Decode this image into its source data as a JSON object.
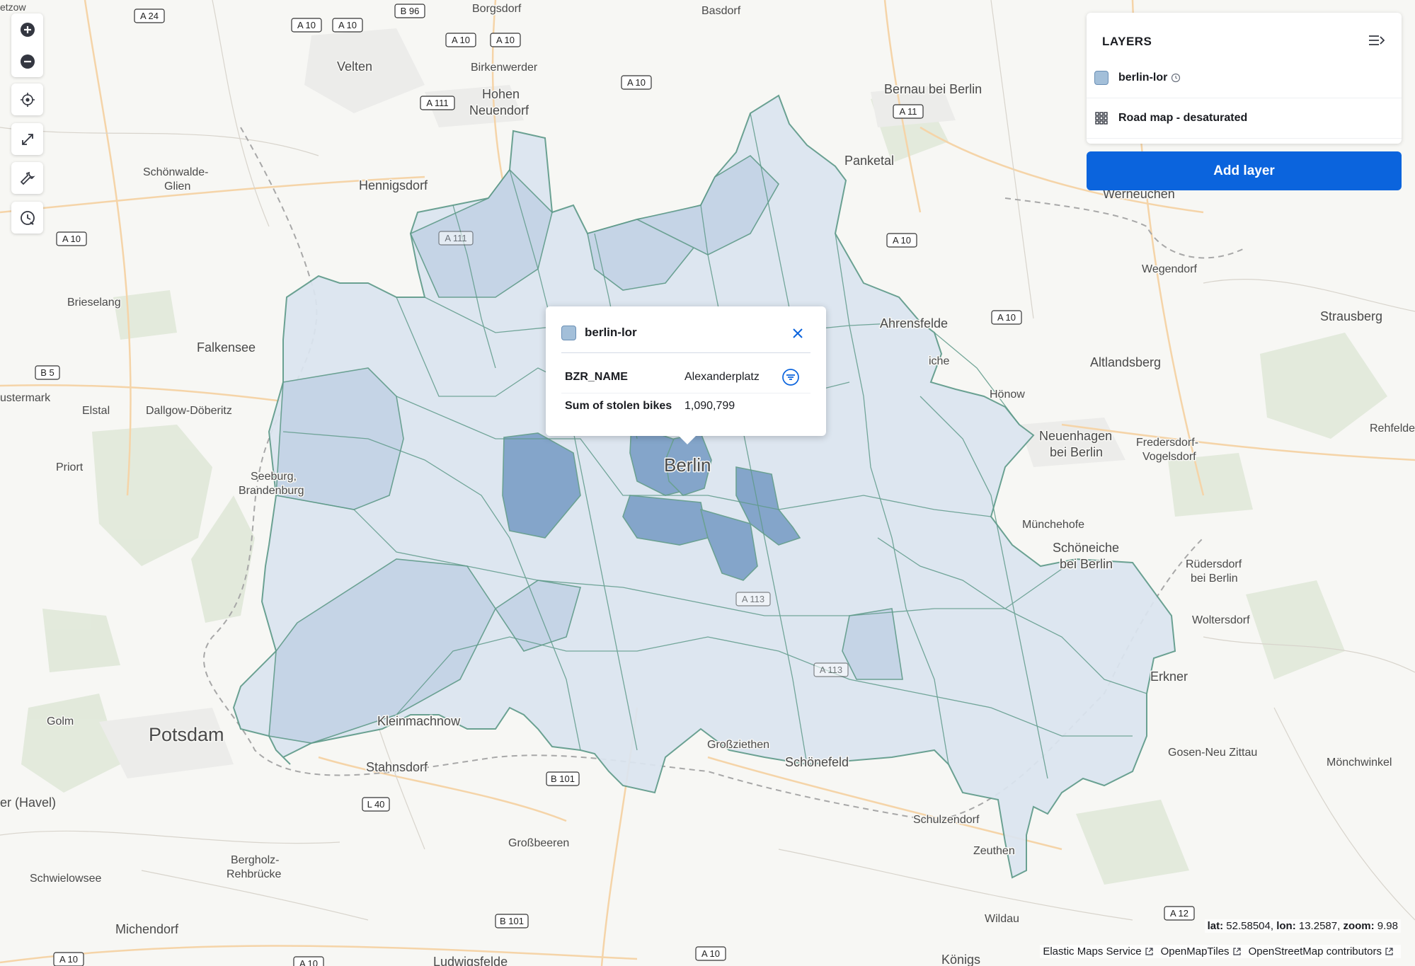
{
  "places": [
    {
      "name": "Borgsdorf",
      "size": 16
    },
    {
      "name": "Basdorf",
      "size": 16
    },
    {
      "name": "Velten",
      "size": 18
    },
    {
      "name": "Birkenwerder",
      "size": 16
    },
    {
      "name": "Hohen",
      "size": 18
    },
    {
      "name": "Neuendorf",
      "size": 18
    },
    {
      "name": "Bernau bei Berlin",
      "size": 18
    },
    {
      "name": "Schönwalde-",
      "size": 16
    },
    {
      "name": "Glien",
      "size": 16
    },
    {
      "name": "Hennigsdorf",
      "size": 18
    },
    {
      "name": "Panketal",
      "size": 18
    },
    {
      "name": "Werneuchen",
      "size": 18
    },
    {
      "name": "Wegendorf",
      "size": 16
    },
    {
      "name": "Brieselang",
      "size": 16
    },
    {
      "name": "Falkensee",
      "size": 18
    },
    {
      "name": "Ahrensfelde",
      "size": 18
    },
    {
      "name": "Strausberg",
      "size": 18
    },
    {
      "name": "Altlandsberg",
      "size": 18
    },
    {
      "name": "ustermark",
      "size": 16
    },
    {
      "name": "Elstal",
      "size": 16
    },
    {
      "name": "Dallgow-Döberitz",
      "size": 16
    },
    {
      "name": "Hönow",
      "size": 16
    },
    {
      "name": "iche",
      "size": 16
    },
    {
      "name": "Neuenhagen",
      "size": 18
    },
    {
      "name": "bei Berlin",
      "size": 18
    },
    {
      "name": "Fredersdorf-",
      "size": 16
    },
    {
      "name": "Vogelsdorf",
      "size": 16
    },
    {
      "name": "Rehfelde",
      "size": 16
    },
    {
      "name": "Priort",
      "size": 16
    },
    {
      "name": "Seeburg,",
      "size": 16
    },
    {
      "name": "Brandenburg",
      "size": 16
    },
    {
      "name": "Berlin",
      "size": 26
    },
    {
      "name": "Münchehofe",
      "size": 16
    },
    {
      "name": "Schöneiche",
      "size": 18
    },
    {
      "name": "bei Berlin",
      "size": 18
    },
    {
      "name": "Rüdersdorf",
      "size": 16
    },
    {
      "name": "bei Berlin",
      "size": 16
    },
    {
      "name": "Woltersdorf",
      "size": 16
    },
    {
      "name": "Erkner",
      "size": 18
    },
    {
      "name": "Golm",
      "size": 16
    },
    {
      "name": "Potsdam",
      "size": 27
    },
    {
      "name": "Kleinmachnow",
      "size": 18
    },
    {
      "name": "Großziethen",
      "size": 16
    },
    {
      "name": "Schönefeld",
      "size": 18
    },
    {
      "name": "Gosen-Neu Zittau",
      "size": 16
    },
    {
      "name": "Mönchwinkel",
      "size": 16
    },
    {
      "name": "Stahnsdorf",
      "size": 18
    },
    {
      "name": "er (Havel)",
      "size": 18
    },
    {
      "name": "Schulzendorf",
      "size": 16
    },
    {
      "name": "Großbeeren",
      "size": 16
    },
    {
      "name": "Zeuthen",
      "size": 16
    },
    {
      "name": "Bergholz-",
      "size": 16
    },
    {
      "name": "Rehbrücke",
      "size": 16
    },
    {
      "name": "Schwielowsee",
      "size": 16
    },
    {
      "name": "Wildau",
      "size": 16
    },
    {
      "name": "Michendorf",
      "size": 18
    },
    {
      "name": "Ludwigsfelde",
      "size": 18
    },
    {
      "name": "Königs",
      "size": 18
    },
    {
      "name": "etzow",
      "size": 14
    }
  ],
  "road_shields": [
    "A 24",
    "A 10",
    "A 10",
    "B 96",
    "A 10",
    "A 10",
    "A 10",
    "A 111",
    "A 11",
    "A 10",
    "A 10",
    "A 111",
    "A 10",
    "B 5",
    "A 113",
    "A 113",
    "B 101",
    "L 40",
    "A 10",
    "A 10",
    "B 101",
    "A 10",
    "A 12"
  ],
  "toolbar": {
    "zoom_in": "plus-icon",
    "zoom_out": "minus-icon",
    "set_view": "crosshair-icon",
    "fit_bounds": "expand-icon",
    "tools": "wrench-icon",
    "time_slider": "clock-icon"
  },
  "layers_panel": {
    "title": "LAYERS",
    "layers": [
      {
        "name": "berlin-lor",
        "swatch_color": "#a3bfd9",
        "icon": "clock-icon"
      },
      {
        "name": "Road map - desaturated",
        "icon": "grid-icon"
      }
    ],
    "add_layer_label": "Add layer"
  },
  "tooltip": {
    "layer_name": "berlin-lor",
    "rows": [
      {
        "key": "BZR_NAME",
        "value": "Alexanderplatz"
      },
      {
        "key": "Sum of stolen bikes",
        "value": "1,090,799"
      }
    ]
  },
  "status": {
    "lat_label": "lat:",
    "lat": "52.58504",
    "lon_label": "lon:",
    "lon": "13.2587",
    "zoom_label": "zoom:",
    "zoom": "9.98"
  },
  "attribution": [
    "Elastic Maps Service",
    "OpenMapTiles",
    "OpenStreetMap contributors"
  ],
  "colors": {
    "accent": "#0b64dd",
    "region_fill": "#dbe5f0",
    "region_stroke": "#5f9a8a",
    "region_dark": "#7b9fc6"
  }
}
